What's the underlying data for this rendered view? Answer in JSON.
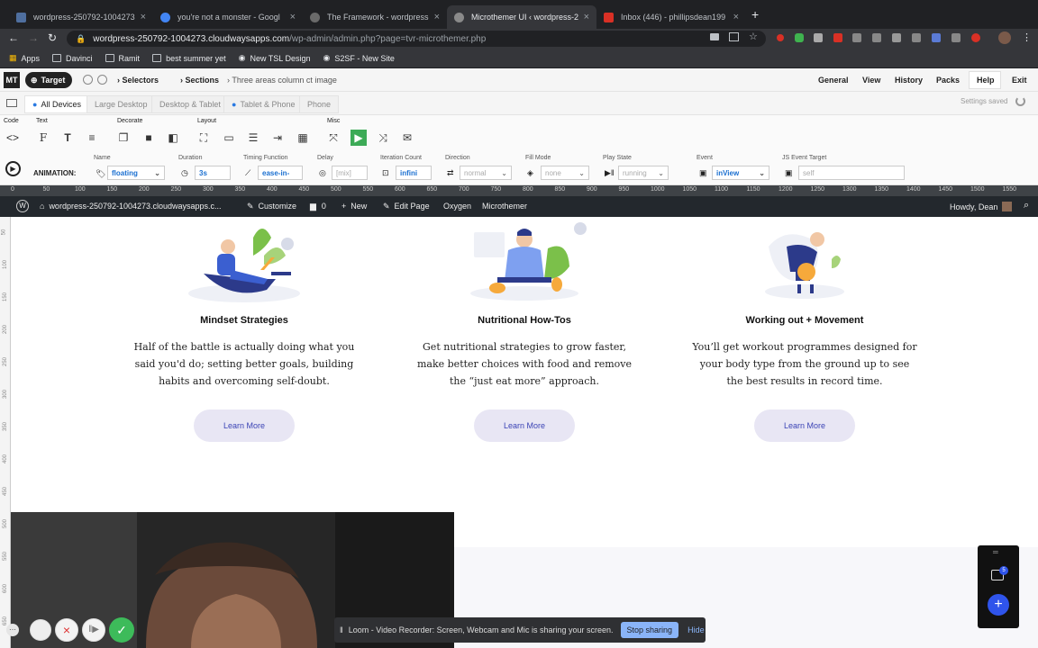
{
  "browser": {
    "tabs": [
      {
        "title": "wordpress-250792-1004273.c",
        "color": "#4f6f9f"
      },
      {
        "title": "you're not a monster - Googl",
        "color": "#4285f4"
      },
      {
        "title": "The Framework - wordpress-2",
        "color": "#6a6a6a"
      },
      {
        "title": "Microthemer UI ‹ wordpress-2",
        "color": "#6a6a6a"
      },
      {
        "title": "Inbox (446) - phillipsdean199",
        "color": "#d93025"
      }
    ],
    "active_tab": 3,
    "url_host": "wordpress-250792-1004273.cloudwaysapps.com",
    "url_path": "/wp-admin/admin.php?page=tvr-microthemer.php",
    "bookmarks": [
      "Apps",
      "Davinci",
      "Ramit",
      "best summer yet",
      "New TSL Design",
      "S2SF - New Site"
    ]
  },
  "mt": {
    "logo": "MT",
    "target_label": "Target",
    "breadcrumb": [
      "Selectors",
      "Sections",
      "Three areas column ct image"
    ],
    "menu": [
      "General",
      "View",
      "History",
      "Packs",
      "Help",
      "Exit"
    ],
    "devices": [
      "All Devices",
      "Large Desktop",
      "Desktop & Tablet",
      "Tablet & Phone",
      "Phone"
    ],
    "settings_saved": "Settings saved",
    "groups": [
      "Code",
      "Text",
      "Decorate",
      "Layout",
      "Misc"
    ],
    "animation": {
      "label": "ANIMATION:",
      "fields": [
        {
          "label": "Name",
          "value": "floating"
        },
        {
          "label": "Duration",
          "value": "3s"
        },
        {
          "label": "Timing Function",
          "value": "ease-in-"
        },
        {
          "label": "Delay",
          "value": "[mix]"
        },
        {
          "label": "Iteration Count",
          "value": "infini"
        },
        {
          "label": "Direction",
          "value": "normal"
        },
        {
          "label": "Fill Mode",
          "value": "none"
        },
        {
          "label": "Play State",
          "value": "running"
        },
        {
          "label": "Event",
          "value": "inView"
        },
        {
          "label": "JS Event Target",
          "value": "self"
        }
      ]
    },
    "ruler_ticks": [
      "0",
      "50",
      "100",
      "150",
      "200",
      "250",
      "300",
      "350",
      "400",
      "450",
      "500",
      "550",
      "600",
      "650",
      "700",
      "750",
      "800",
      "850",
      "900",
      "950",
      "1000",
      "1050",
      "1100",
      "1150",
      "1200",
      "1250",
      "1300",
      "1350",
      "1400",
      "1450",
      "1500",
      "1550",
      "1600"
    ]
  },
  "wpbar": {
    "site": "wordpress-250792-1004273.cloudwaysapps.c...",
    "customize": "Customize",
    "comments": "0",
    "new": "New",
    "edit_page": "Edit Page",
    "oxygen": "Oxygen",
    "microthemer": "Microthemer",
    "howdy": "Howdy, Dean"
  },
  "cards": [
    {
      "title": "Mindset Strategies",
      "lines": [
        "Half of the battle is actually doing what you",
        "said you'd do; setting better goals, building",
        "habits and overcoming self-doubt."
      ],
      "button": "Learn More"
    },
    {
      "title": "Nutritional How-Tos",
      "lines": [
        "Get nutritional strategies to grow faster,",
        "make better choices with food and remove",
        "the “just eat more” approach."
      ],
      "button": "Learn More"
    },
    {
      "title": "Working out + Movement",
      "lines": [
        "You’ll get workout programmes designed for",
        "your body type from the ground up to see",
        "the best results in record time."
      ],
      "button": "Learn More"
    }
  ],
  "loom": {
    "message": "Loom - Video Recorder: Screen, Webcam and Mic is sharing your screen.",
    "stop": "Stop sharing",
    "hide": "Hide"
  },
  "widget": {
    "badge": "5"
  }
}
